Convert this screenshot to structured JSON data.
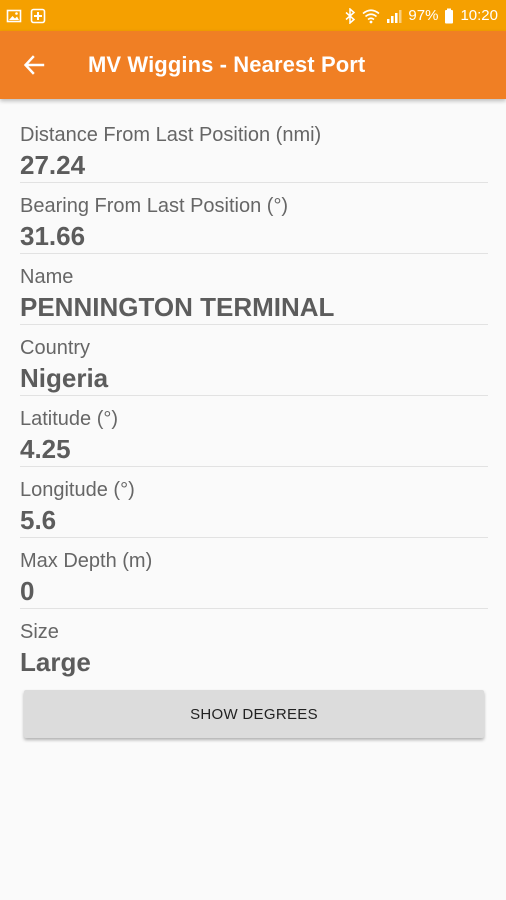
{
  "status_bar": {
    "battery": "97%",
    "time": "10:20",
    "icons": [
      "image-icon",
      "medical-cross-icon",
      "bluetooth-icon",
      "wifi-icon",
      "signal-icon",
      "battery-icon"
    ]
  },
  "app_bar": {
    "title": "MV Wiggins - Nearest Port",
    "back_icon": "arrow-back-icon"
  },
  "fields": [
    {
      "label": "Distance From Last Position (nmi)",
      "value": "27.24"
    },
    {
      "label": "Bearing From Last Position (°)",
      "value": "31.66"
    },
    {
      "label": "Name",
      "value": "PENNINGTON TERMINAL"
    },
    {
      "label": "Country",
      "value": "Nigeria"
    },
    {
      "label": "Latitude (°)",
      "value": "4.25"
    },
    {
      "label": "Longitude (°)",
      "value": "5.6"
    },
    {
      "label": "Max Depth (m)",
      "value": "0"
    },
    {
      "label": "Size",
      "value": "Large"
    }
  ],
  "show_degrees_button": "SHOW DEGREES",
  "colors": {
    "status_bar": "#f5a000",
    "app_bar": "#f07f24",
    "background": "#fafafa"
  }
}
